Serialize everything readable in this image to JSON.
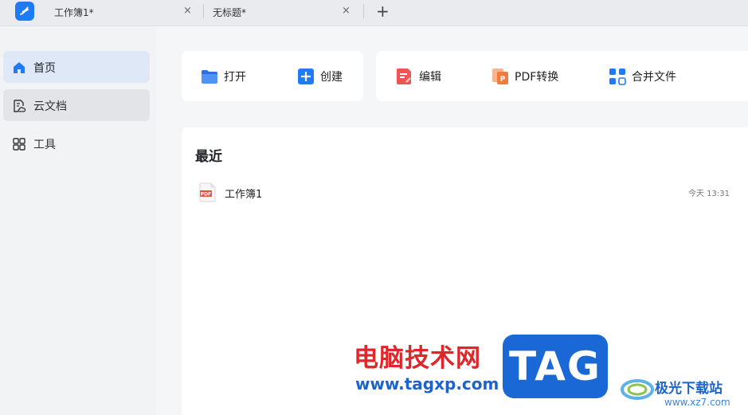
{
  "tabs": [
    {
      "label": "工作簿1*"
    },
    {
      "label": "无标题*"
    }
  ],
  "new_tab": "+",
  "close_glyph": "×",
  "sidebar": {
    "items": [
      {
        "label": "首页",
        "icon": "home-icon",
        "state": "active"
      },
      {
        "label": "云文档",
        "icon": "cloud-doc-icon",
        "state": "hover"
      },
      {
        "label": "工具",
        "icon": "grid-icon",
        "state": "normal"
      }
    ]
  },
  "quick_actions": [
    {
      "label": "打开",
      "icon": "folder-open-icon"
    },
    {
      "label": "创建",
      "icon": "plus-square-icon"
    },
    {
      "label": "编辑",
      "icon": "edit-doc-icon"
    },
    {
      "label": "PDF转换",
      "icon": "pdf-convert-icon"
    },
    {
      "label": "合并文件",
      "icon": "merge-files-icon"
    }
  ],
  "recent": {
    "title": "最近",
    "files": [
      {
        "name": "工作簿1",
        "time": "今天 13:31",
        "badge": "PDF"
      }
    ]
  },
  "watermark": {
    "site_cn": "电脑技术网",
    "site_url": "www.tagxp.com",
    "tag": "TAG",
    "right_cn": "极光下载站",
    "right_url": "www.xz7.com"
  },
  "colors": {
    "accent": "#1e7bf5",
    "nav_active": "#dfe8f7",
    "edit_red": "#f25454",
    "pdf_orange": "#f07b3f",
    "watermark_red": "#e0262a",
    "watermark_blue": "#1d63c9"
  }
}
